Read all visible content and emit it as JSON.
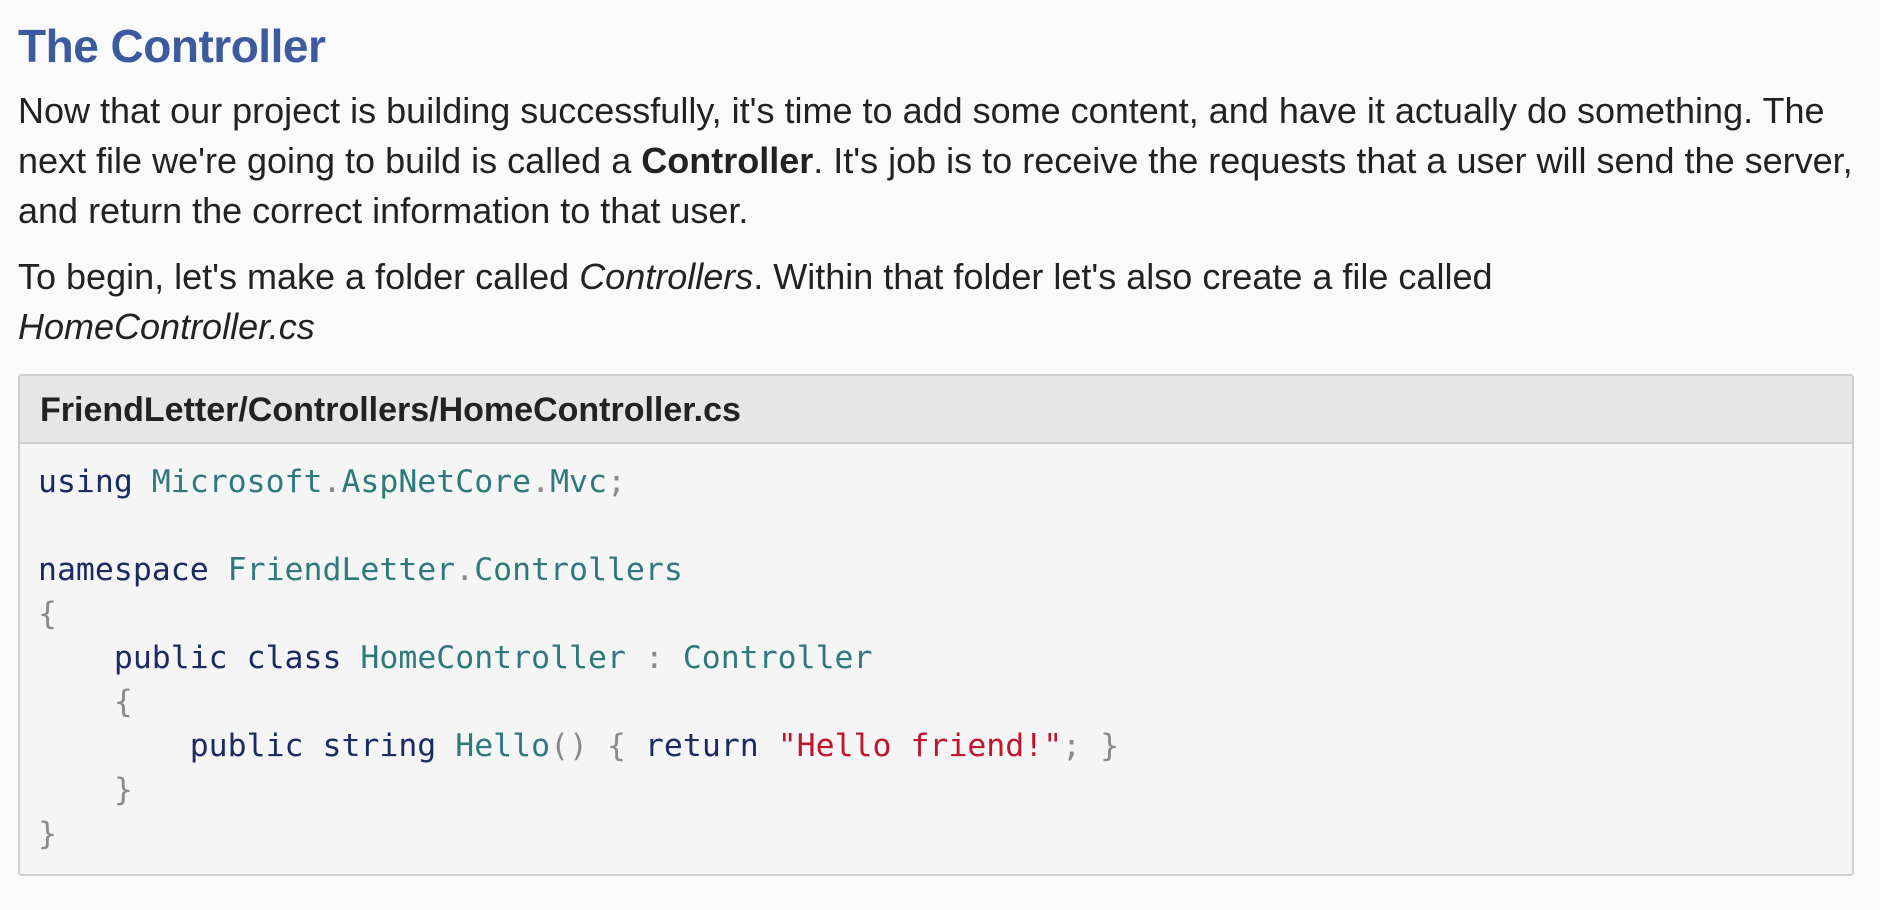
{
  "section": {
    "title": "The Controller"
  },
  "paragraph1": {
    "before_bold": "Now that our project is building successfully, it's time to add some content, and have it actually do something. The next file we're going to build is called a ",
    "bold": "Controller",
    "after_bold": ". It's job is to receive the requests that a user will send the server, and return the correct information to that user."
  },
  "paragraph2": {
    "before_italic1": "To begin, let's make a folder called ",
    "italic1": "Controllers",
    "between": ". Within that folder let's also create a file called ",
    "italic2": "HomeController.cs"
  },
  "code_block": {
    "file_path": "FriendLetter/Controllers/HomeController.cs",
    "tokens": {
      "using": "using",
      "ns_microsoft": "Microsoft",
      "ns_aspnetcore": "AspNetCore",
      "ns_mvc": "Mvc",
      "namespace": "namespace",
      "ns_friendletter": "FriendLetter",
      "ns_controllers": "Controllers",
      "public1": "public",
      "class": "class",
      "class_name": "HomeController",
      "base_class": "Controller",
      "public2": "public",
      "string_type": "string",
      "method_name": "Hello",
      "return": "return",
      "string_literal": "\"Hello friend!\""
    }
  }
}
